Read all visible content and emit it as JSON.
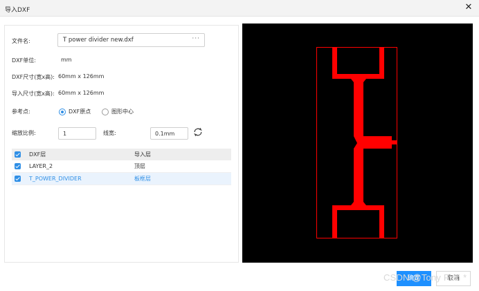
{
  "dialog": {
    "title": "导入DXF",
    "close_glyph": "✕"
  },
  "form": {
    "filename_label": "文件名:",
    "filename_value": "T power divider new.dxf",
    "browse_glyph": "···",
    "unit_label": "DXF单位:",
    "unit_value": "mm",
    "dxf_size_label": "DXF尺寸(宽x高):",
    "dxf_size_value": "60mm x 126mm",
    "import_size_label": "导入尺寸(宽x高):",
    "import_size_value": "60mm x 126mm",
    "ref_point_label": "参考点:",
    "ref_options": [
      {
        "label": "DXF原点",
        "checked": true
      },
      {
        "label": "图形中心",
        "checked": false
      }
    ],
    "scale_label": "缩放比例:",
    "scale_value": "1",
    "linewidth_label": "线宽:",
    "linewidth_value": "0.1mm"
  },
  "layer_table": {
    "headers": [
      "DXF层",
      "导入层"
    ],
    "rows": [
      {
        "dxf_layer": "LAYER_2",
        "import_layer": "顶层",
        "checked": true
      },
      {
        "dxf_layer": "T_POWER_DIVIDER",
        "import_layer": "板框层",
        "checked": true
      }
    ]
  },
  "footer": {
    "ok_label": "确定",
    "cancel_label": "取消"
  },
  "watermark": "CSDN @Tony Ren *",
  "colors": {
    "accent": "#1e90ff",
    "trace": "#ff0000",
    "preview_bg": "#000000"
  },
  "icons": {
    "close": "close-icon",
    "browse": "ellipsis-icon",
    "refresh": "refresh-icon",
    "checkbox": "checkbox-checked-icon"
  }
}
